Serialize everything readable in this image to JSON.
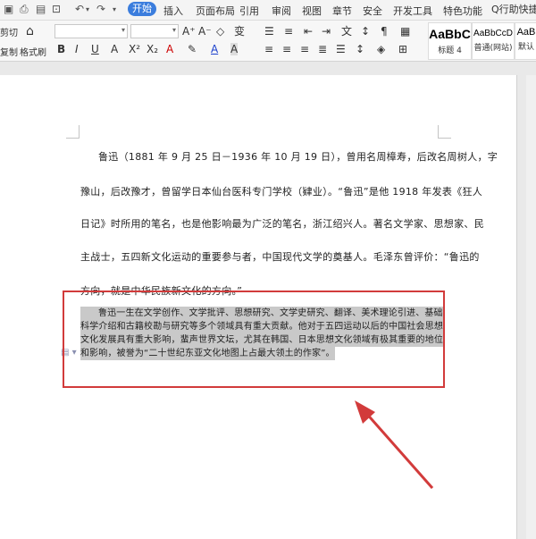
{
  "menu": {
    "active_tab": "开始",
    "tabs": [
      "插入",
      "页面布局",
      "引用",
      "审阅",
      "视图",
      "章节",
      "安全",
      "开发工具",
      "特色功能"
    ],
    "search": "Q行助快捷"
  },
  "ribbon": {
    "cut": "剪切",
    "copy": "复制",
    "format_painter": "格式刷",
    "styles": [
      {
        "sample": "AaBbC",
        "name": "标题 4"
      },
      {
        "sample": "AaBbCcD",
        "name": "普通(网站)"
      },
      {
        "sample": "AaB",
        "name": "默认"
      }
    ]
  },
  "document": {
    "lines": [
      "鲁迅（1881 年 9 月 25 日－1936 年 10 月 19 日），曾用名周樟寿，后改名周树人，字",
      "豫山，后改豫才，曾留学日本仙台医科专门学校（肄业）。“鲁迅”是他 1918 年发表《狂人",
      "日记》时所用的笔名，也是他影响最为广泛的笔名，浙江绍兴人。著名文学家、思想家、民",
      "主战士，五四新文化运动的重要参与者，中国现代文学的奠基人。毛泽东曾评价：“鲁迅的",
      "方向，就是中华民族新文化的方向。”"
    ],
    "highlighted_lines": [
      "鲁迅一生在文学创作、文学批评、思想研究、文学史研究、翻译、美术理论引进、基础",
      "科学介绍和古籍校勘与研究等多个领域具有重大贡献。他对于五四运动以后的中国社会思想",
      "文化发展具有重大影响，蜚声世界文坛，尤其在韩国、日本思想文化领域有极其重要的地位",
      "和影响，被誉为“二十世纪东亚文化地图上占最大领土的作家”。"
    ]
  },
  "colors": {
    "accent": "#3b7ddd",
    "annotation": "#d23b3b",
    "selection": "#c9c9c9"
  }
}
